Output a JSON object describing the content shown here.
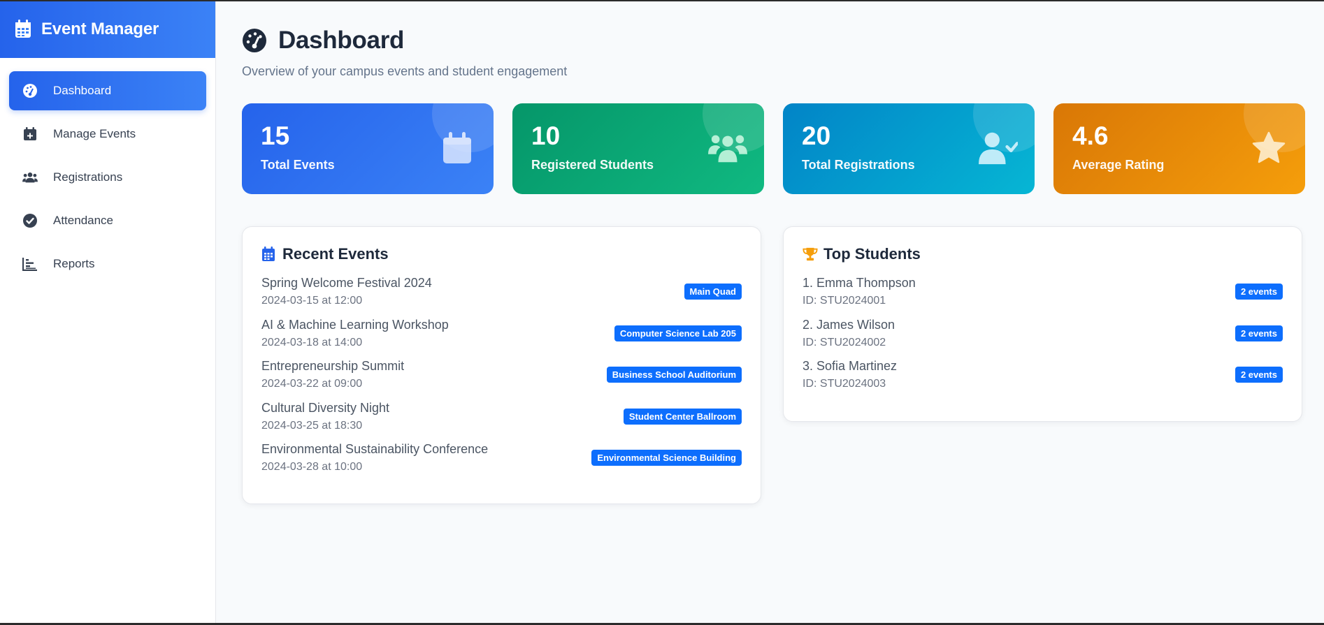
{
  "brand": {
    "title": "Event Manager",
    "icon": "calendar-icon"
  },
  "nav": {
    "items": [
      {
        "label": "Dashboard",
        "icon": "dashboard-gauge-icon",
        "active": true
      },
      {
        "label": "Manage Events",
        "icon": "calendar-plus-icon",
        "active": false
      },
      {
        "label": "Registrations",
        "icon": "users-icon",
        "active": false
      },
      {
        "label": "Attendance",
        "icon": "check-circle-icon",
        "active": false
      },
      {
        "label": "Reports",
        "icon": "chart-icon",
        "active": false
      }
    ]
  },
  "header": {
    "title": "Dashboard",
    "subtitle": "Overview of your campus events and student engagement",
    "icon": "dashboard-gauge-icon"
  },
  "stats": [
    {
      "value": "15",
      "label": "Total Events",
      "icon": "calendar-icon",
      "color": "#2563eb"
    },
    {
      "value": "10",
      "label": "Registered Students",
      "icon": "users-icon",
      "color": "#059669"
    },
    {
      "value": "20",
      "label": "Total Registrations",
      "icon": "user-check-icon",
      "color": "#0284c7"
    },
    {
      "value": "4.6",
      "label": "Average Rating",
      "icon": "star-icon",
      "color": "#d97706"
    }
  ],
  "recent_events": {
    "title": "Recent Events",
    "icon": "calendar-icon",
    "items": [
      {
        "name": "Spring Welcome Festival 2024",
        "when": "2024-03-15 at 12:00",
        "location": "Main Quad"
      },
      {
        "name": "AI & Machine Learning Workshop",
        "when": "2024-03-18 at 14:00",
        "location": "Computer Science Lab 205"
      },
      {
        "name": "Entrepreneurship Summit",
        "when": "2024-03-22 at 09:00",
        "location": "Business School Auditorium"
      },
      {
        "name": "Cultural Diversity Night",
        "when": "2024-03-25 at 18:30",
        "location": "Student Center Ballroom"
      },
      {
        "name": "Environmental Sustainability Conference",
        "when": "2024-03-28 at 10:00",
        "location": "Environmental Science Building"
      }
    ]
  },
  "top_students": {
    "title": "Top Students",
    "icon": "trophy-icon",
    "items": [
      {
        "name": "1. Emma Thompson",
        "id": "ID: STU2024001",
        "count": "2 events"
      },
      {
        "name": "2. James Wilson",
        "id": "ID: STU2024002",
        "count": "2 events"
      },
      {
        "name": "3. Sofia Martinez",
        "id": "ID: STU2024003",
        "count": "2 events"
      }
    ]
  },
  "colors": {
    "accent": "#2563eb",
    "badge": "#0d6efd",
    "trophy": "#f59e0b"
  }
}
